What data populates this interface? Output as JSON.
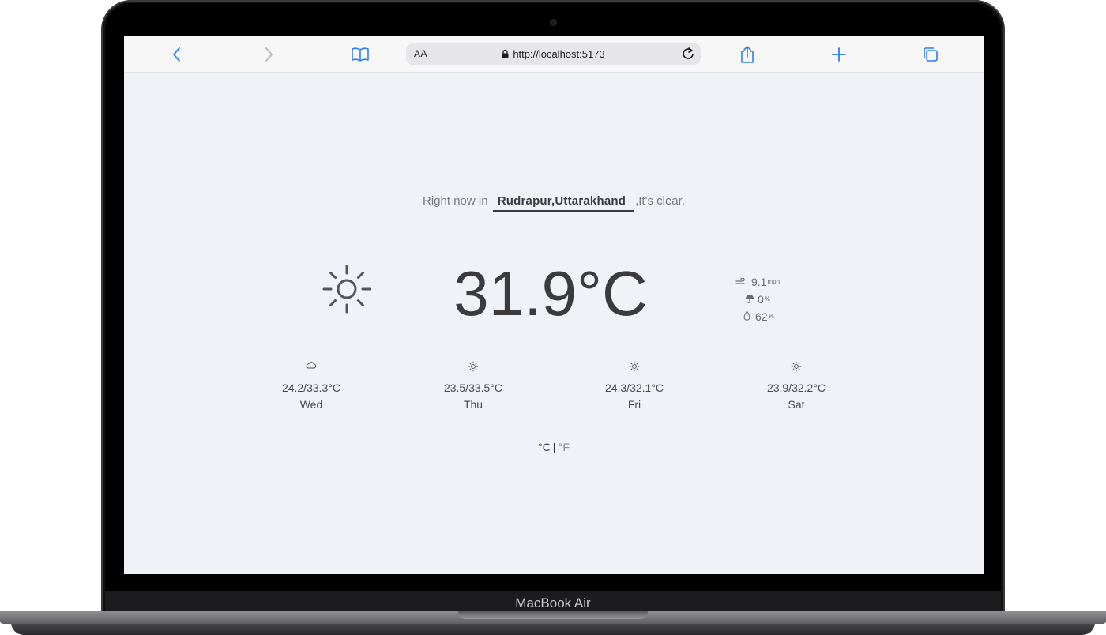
{
  "device": {
    "label": "MacBook Air"
  },
  "browser": {
    "text_size_label": "AA",
    "url": "http://localhost:5173",
    "icons": [
      "back-icon",
      "forward-icon",
      "bookmarks-icon",
      "lock-icon",
      "reload-icon",
      "share-icon",
      "new-tab-icon",
      "tabs-icon"
    ]
  },
  "weather": {
    "prefix": "Right now in",
    "city": "Rudrapur,Uttarakhand",
    "suffix": ",It's clear.",
    "condition_icon": "sun-icon",
    "temperature": "31.9°C",
    "wind": {
      "value": "9.1",
      "unit": "mph",
      "icon": "wind-icon"
    },
    "precipitation": {
      "value": "0",
      "unit": "%",
      "icon": "umbrella-icon"
    },
    "humidity": {
      "value": "62",
      "unit": "%",
      "icon": "droplet-icon"
    }
  },
  "forecast": [
    {
      "day": "Wed",
      "temps": "24.2/33.3°C",
      "icon": "cloud-icon"
    },
    {
      "day": "Thu",
      "temps": "23.5/33.5°C",
      "icon": "sun-icon"
    },
    {
      "day": "Fri",
      "temps": "24.3/32.1°C",
      "icon": "sun-icon"
    },
    {
      "day": "Sat",
      "temps": "23.9/32.2°C",
      "icon": "sun-icon"
    }
  ],
  "units": {
    "celsius": "°C",
    "separator": "|",
    "fahrenheit": "°F"
  }
}
